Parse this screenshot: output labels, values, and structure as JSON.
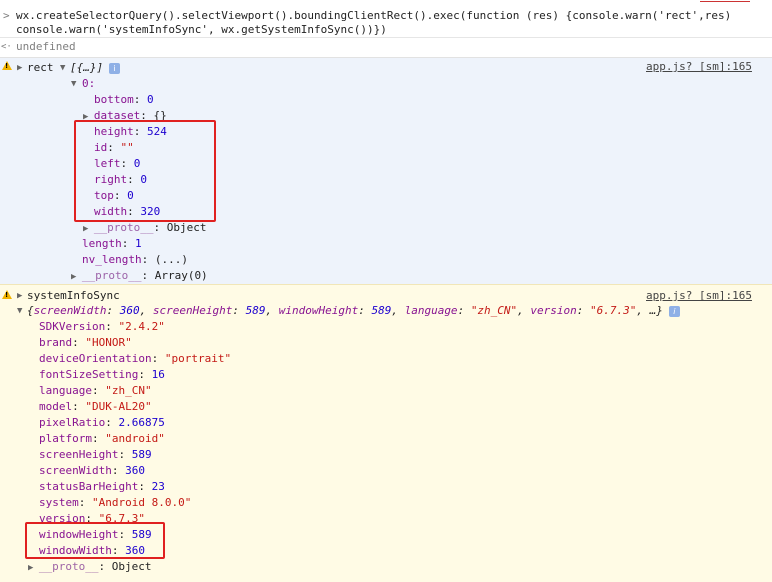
{
  "command": {
    "prompt": ">",
    "line1": "wx.createSelectorQuery().selectViewport().boundingClientRect().exec(function (res) {console.warn('rect',res)",
    "line2": "console.warn('systemInfoSync', wx.getSystemInfoSync())})",
    "result_prompt": "<·",
    "result": "undefined"
  },
  "rect_log": {
    "label": "rect",
    "summary": "[{…}]",
    "source": "app.js? [sm]:165",
    "index": "0:",
    "props": [
      {
        "k": "bottom",
        "v": "0",
        "t": "num"
      },
      {
        "k": "dataset",
        "v": "{}",
        "t": "obj"
      },
      {
        "k": "height",
        "v": "524",
        "t": "num"
      },
      {
        "k": "id",
        "v": "\"\"",
        "t": "str"
      },
      {
        "k": "left",
        "v": "0",
        "t": "num"
      },
      {
        "k": "right",
        "v": "0",
        "t": "num"
      },
      {
        "k": "top",
        "v": "0",
        "t": "num"
      },
      {
        "k": "width",
        "v": "320",
        "t": "num"
      },
      {
        "k": "__proto__",
        "v": "Object",
        "t": "obj"
      }
    ],
    "array_props": [
      {
        "k": "length",
        "v": "1"
      },
      {
        "k": "nv_length",
        "v": "(...)"
      },
      {
        "k": "__proto__",
        "v": "Array(0)"
      }
    ]
  },
  "sys_log": {
    "label": "systemInfoSync",
    "source": "app.js? [sm]:165",
    "summary_parts": [
      {
        "k": "screenWidth",
        "v": "360",
        "t": "num"
      },
      {
        "k": "screenHeight",
        "v": "589",
        "t": "num"
      },
      {
        "k": "windowHeight",
        "v": "589",
        "t": "num"
      },
      {
        "k": "language",
        "v": "\"zh_CN\"",
        "t": "str"
      },
      {
        "k": "version",
        "v": "\"6.7.3\"",
        "t": "str"
      }
    ],
    "summary_tail": "…}",
    "props": [
      {
        "k": "SDKVersion",
        "v": "\"2.4.2\"",
        "t": "str"
      },
      {
        "k": "brand",
        "v": "\"HONOR\"",
        "t": "str"
      },
      {
        "k": "deviceOrientation",
        "v": "\"portrait\"",
        "t": "str"
      },
      {
        "k": "fontSizeSetting",
        "v": "16",
        "t": "num"
      },
      {
        "k": "language",
        "v": "\"zh_CN\"",
        "t": "str"
      },
      {
        "k": "model",
        "v": "\"DUK-AL20\"",
        "t": "str"
      },
      {
        "k": "pixelRatio",
        "v": "2.66875",
        "t": "num"
      },
      {
        "k": "platform",
        "v": "\"android\"",
        "t": "str"
      },
      {
        "k": "screenHeight",
        "v": "589",
        "t": "num"
      },
      {
        "k": "screenWidth",
        "v": "360",
        "t": "num"
      },
      {
        "k": "statusBarHeight",
        "v": "23",
        "t": "num"
      },
      {
        "k": "system",
        "v": "\"Android 8.0.0\"",
        "t": "str"
      },
      {
        "k": "version",
        "v": "\"6.7.3\"",
        "t": "str"
      },
      {
        "k": "windowHeight",
        "v": "589",
        "t": "num"
      },
      {
        "k": "windowWidth",
        "v": "360",
        "t": "num"
      },
      {
        "k": "__proto__",
        "v": "Object",
        "t": "obj"
      }
    ]
  },
  "colors": {
    "highlight_box": "#e02020",
    "warn_bg": "#fffbe5",
    "rect_bg": "#eef3fb",
    "key": "#881391",
    "number": "#1c00cf",
    "string": "#c41a16"
  }
}
